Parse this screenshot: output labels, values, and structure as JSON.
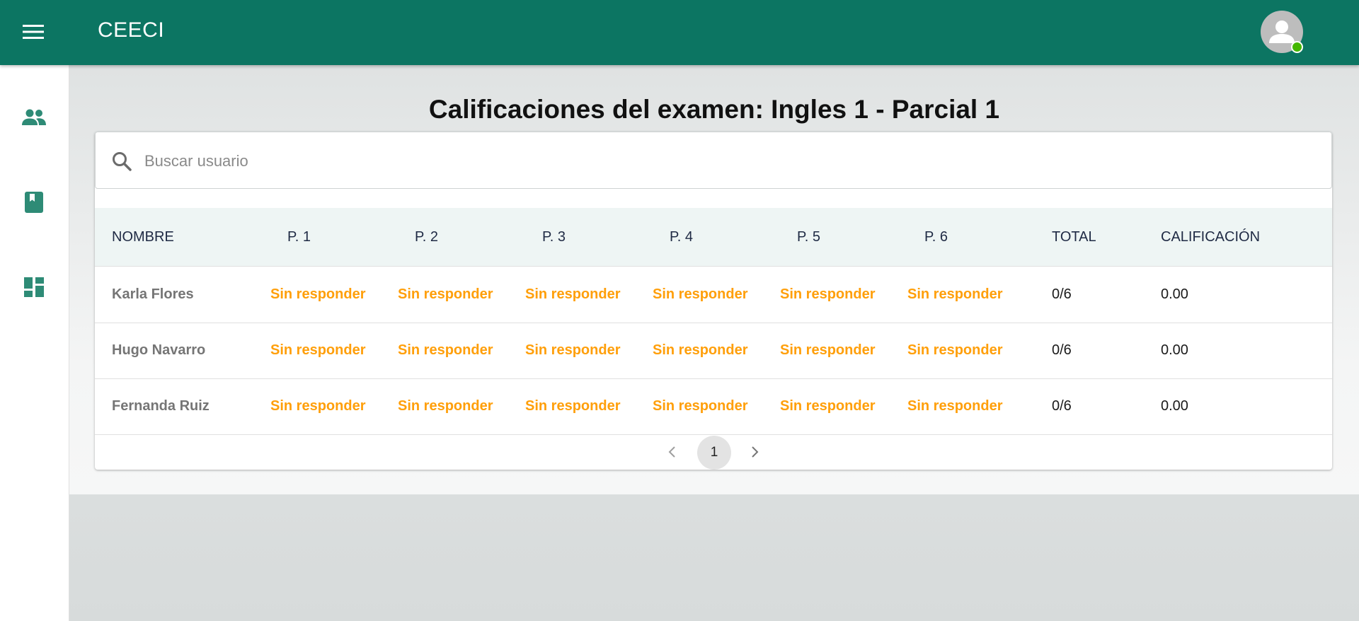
{
  "app": {
    "title": "CEECI",
    "brand_color": "#0c7562",
    "online_status_color": "#44b700"
  },
  "icons": {
    "menu": "hamburger-menu-icon",
    "avatar": "user-avatar-icon",
    "sidebar": [
      "people-icon",
      "book-icon",
      "dashboard-icon"
    ],
    "search": "search-icon",
    "pager_prev": "chevron-left-icon",
    "pager_next": "chevron-right-icon"
  },
  "page": {
    "title": "Calificaciones del examen: Ingles 1 - Parcial 1"
  },
  "search": {
    "placeholder": "Buscar usuario",
    "value": ""
  },
  "table": {
    "columns": [
      "NOMBRE",
      "P. 1",
      "P. 2",
      "P. 3",
      "P. 4",
      "P. 5",
      "P. 6",
      "TOTAL",
      "CALIFICACIÓN"
    ],
    "status_color": "#ff9f0a",
    "rows": [
      {
        "name": "Karla Flores",
        "answers": [
          "Sin responder",
          "Sin responder",
          "Sin responder",
          "Sin responder",
          "Sin responder",
          "Sin responder"
        ],
        "total": "0/6",
        "grade": "0.00"
      },
      {
        "name": "Hugo Navarro",
        "answers": [
          "Sin responder",
          "Sin responder",
          "Sin responder",
          "Sin responder",
          "Sin responder",
          "Sin responder"
        ],
        "total": "0/6",
        "grade": "0.00"
      },
      {
        "name": "Fernanda Ruiz",
        "answers": [
          "Sin responder",
          "Sin responder",
          "Sin responder",
          "Sin responder",
          "Sin responder",
          "Sin responder"
        ],
        "total": "0/6",
        "grade": "0.00"
      }
    ]
  },
  "pagination": {
    "current_page": "1"
  }
}
